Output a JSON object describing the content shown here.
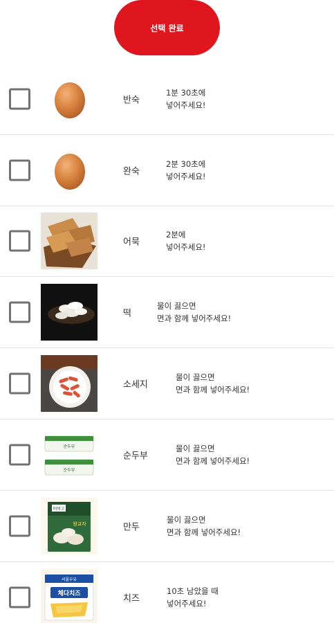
{
  "header": {
    "done_label": "선택 완료"
  },
  "items": [
    {
      "name": "반숙",
      "line1": "1분 30초에",
      "line2": "넣어주세요!"
    },
    {
      "name": "완숙",
      "line1": "2분 30초에",
      "line2": "넣어주세요!"
    },
    {
      "name": "어묵",
      "line1": "2분에",
      "line2": "넣어주세요!"
    },
    {
      "name": "떡",
      "line1": "물이 끓으면",
      "line2": "면과 함께 넣어주세요!"
    },
    {
      "name": "소세지",
      "line1": "물이 끓으면",
      "line2": "면과 함께 넣어주세요!"
    },
    {
      "name": "순두부",
      "line1": "물이 끓으면",
      "line2": "면과 함께 넣어주세요!"
    },
    {
      "name": "만두",
      "line1": "물이 끓으면",
      "line2": "면과 함께 넣어주세요!"
    },
    {
      "name": "치즈",
      "line1": "10초 남았을 때",
      "line2": "넣어주세요!"
    }
  ],
  "package_text": {
    "dubu_small": "순두부",
    "mandu_brand": "비비고",
    "mandu_small": "왕교자",
    "cheese_brand": "서울우유",
    "cheese_name": "체다치즈"
  },
  "icons": [
    "egg-image",
    "egg-image",
    "fishcake-image",
    "rice-cake-image",
    "sausage-image",
    "soft-tofu-image",
    "dumpling-image",
    "cheese-image"
  ],
  "colors": {
    "accent": "#e0161f",
    "checkbox": "#727272",
    "divider": "#e6e6e6"
  }
}
